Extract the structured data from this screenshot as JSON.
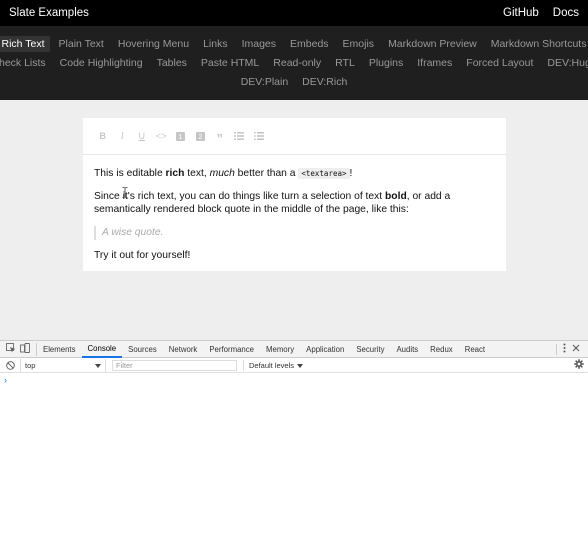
{
  "header": {
    "title": "Slate Examples",
    "links": [
      "GitHub",
      "Docs"
    ]
  },
  "nav": {
    "rows": [
      [
        "Rich Text",
        "Plain Text",
        "Hovering Menu",
        "Links",
        "Images",
        "Embeds",
        "Emojis",
        "Markdown Preview",
        "Markdown Shortcuts"
      ],
      [
        "Check Lists",
        "Code Highlighting",
        "Tables",
        "Paste HTML",
        "Read-only",
        "RTL",
        "Plugins",
        "Iframes",
        "Forced Layout",
        "DEV:Huge"
      ],
      [
        "DEV:Plain",
        "DEV:Rich"
      ]
    ],
    "active": "Rich Text"
  },
  "toolbar": {
    "buttons": [
      "format-bold-icon",
      "format-italic-icon",
      "format-underline-icon",
      "code-icon",
      "heading-one-icon",
      "heading-two-icon",
      "quote-icon",
      "numbered-list-icon",
      "bulleted-list-icon"
    ],
    "labels": {
      "bold": "B",
      "italic": "I",
      "underline": "U",
      "code": "<>",
      "h1": "1",
      "h2": "2",
      "quote": "”"
    }
  },
  "document": {
    "p1": {
      "a": "This is editable ",
      "b": "rich",
      "c": " text, ",
      "d": "much",
      "e": " better than a ",
      "f": "<textarea>",
      "g": "!"
    },
    "p2": {
      "a": "Since it's rich text, you can do things like turn a selection of text ",
      "b": "bold",
      "c": ", or add a semantically rendered block quote in the middle of the page, like this:"
    },
    "quote": "A wise quote.",
    "p3": "Try it out for yourself!"
  },
  "devtools": {
    "tabs": [
      "Elements",
      "Console",
      "Sources",
      "Network",
      "Performance",
      "Memory",
      "Application",
      "Security",
      "Audits",
      "Redux",
      "React"
    ],
    "active_tab": "Console",
    "context": "top",
    "filter_placeholder": "Filter",
    "levels": "Default levels",
    "prompt": "›"
  },
  "colors": {
    "accent": "#1a73e8",
    "header_bg": "#000000",
    "nav_bg": "#1f1f1f",
    "stage_bg": "#eeeeee"
  }
}
